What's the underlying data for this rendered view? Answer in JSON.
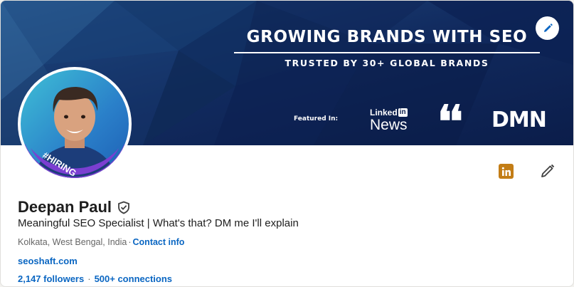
{
  "banner": {
    "headline": "GROWING BRANDS WITH SEO",
    "subheadline": "TRUSTED BY 30+ GLOBAL BRANDS",
    "featured_label": "Featured In:",
    "linkedin_news_top": "Linked",
    "linkedin_news_in": "in",
    "linkedin_news_bottom": "News",
    "quotes_logo": "❛❛",
    "dmn_logo": "DMN",
    "colors": {
      "bg_dark": "#0b1d4a",
      "bg_mid": "#1e3a7a",
      "bg_light": "#3a5da6"
    }
  },
  "avatar": {
    "badge": "#HIRING",
    "badge_color": "#7b3fd1"
  },
  "profile": {
    "name": "Deepan Paul",
    "headline": "Meaningful SEO Specialist | What's that? DM me I'll explain",
    "location": "Kolkata, West Bengal, India",
    "location_separator": "·",
    "contact_info": "Contact info",
    "website": "seoshaft.com",
    "followers": "2,147 followers",
    "stats_separator": "·",
    "connections": "500+ connections"
  },
  "icons": {
    "edit_banner": "pencil-icon",
    "linkedin_badge": "linkedin-icon",
    "edit_profile": "pencil-icon",
    "verified": "shield-check-icon"
  },
  "colors": {
    "link": "#0a66c2",
    "text": "#1d1d1d",
    "muted": "#666666",
    "linkedin_badge": "#c37d16"
  }
}
